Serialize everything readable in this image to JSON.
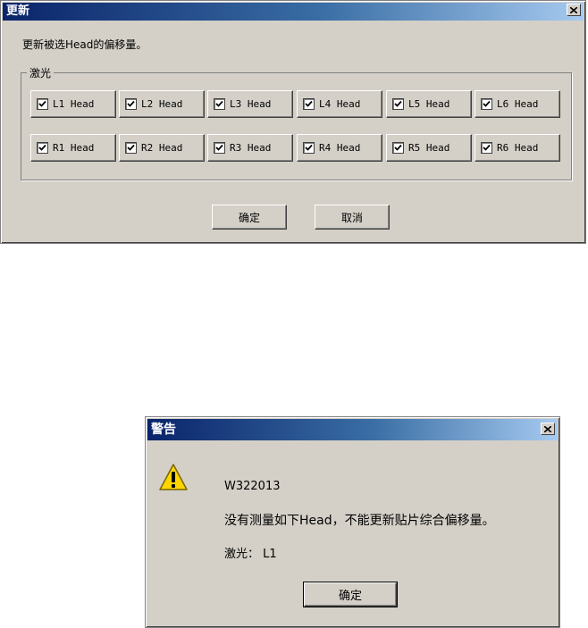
{
  "update_dialog": {
    "title": "更新",
    "instruction": "更新被选Head的偏移量。",
    "group_label": "激光",
    "heads_row1": [
      "L1 Head",
      "L2 Head",
      "L3 Head",
      "L4 Head",
      "L5 Head",
      "L6 Head"
    ],
    "heads_row2": [
      "R1 Head",
      "R2 Head",
      "R3 Head",
      "R4 Head",
      "R5 Head",
      "R6 Head"
    ],
    "ok_label": "确定",
    "cancel_label": "取消"
  },
  "warning_dialog": {
    "title": "警告",
    "code": "W322013",
    "message": "没有测量如下Head，不能更新贴片综合偏移量。",
    "laser_line": "激光： L1",
    "ok_label": "确定"
  }
}
